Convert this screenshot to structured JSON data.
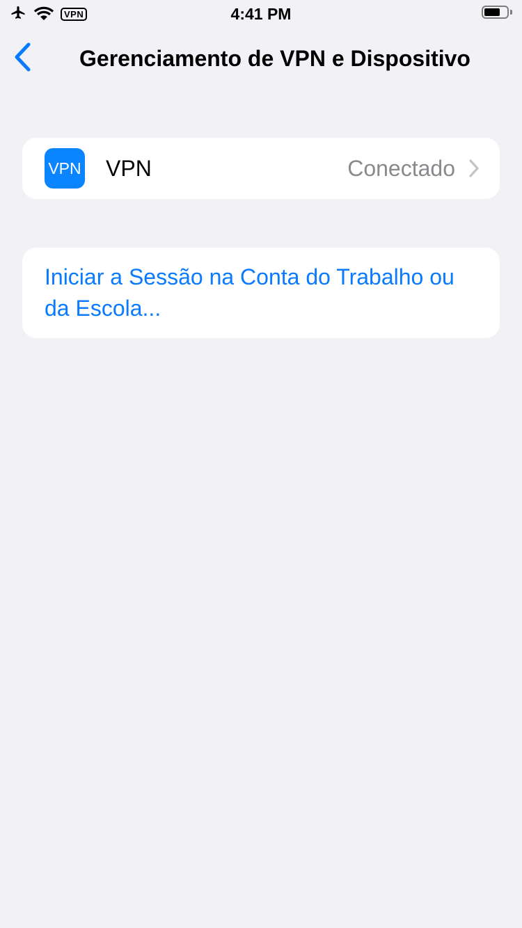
{
  "status_bar": {
    "time": "4:41 PM",
    "vpn_badge": "VPN",
    "icons": [
      "airplane-icon",
      "wifi-icon",
      "battery-icon"
    ]
  },
  "nav": {
    "title": "Gerenciamento de VPN e Dispositivo",
    "back_icon": "chevron-left-icon"
  },
  "vpn_row": {
    "icon_text": "VPN",
    "label": "VPN",
    "status": "Conectado",
    "accessory_icon": "chevron-right-icon"
  },
  "signin": {
    "link": "Iniciar a Sessão na Conta do Trabalho ou da Escola..."
  },
  "colors": {
    "background": "#f1f1f6",
    "accent": "#0a7aff",
    "vpn_icon_bg": "#0a84ff",
    "secondary_text": "#8a8a8e"
  }
}
